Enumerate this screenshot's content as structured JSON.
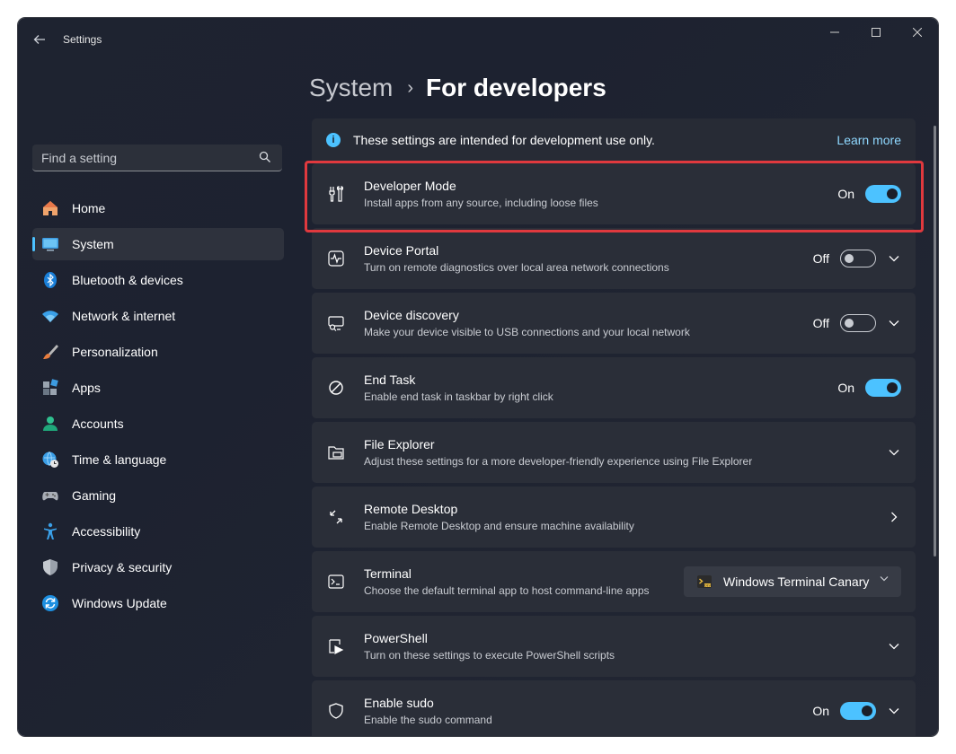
{
  "window": {
    "title": "Settings",
    "controls": {
      "minimize": "–",
      "maximize": "☐",
      "close": "✕"
    }
  },
  "search": {
    "placeholder": "Find a setting"
  },
  "sidebar": {
    "items": [
      {
        "label": "Home",
        "icon": "home-icon"
      },
      {
        "label": "System",
        "icon": "system-icon",
        "active": true
      },
      {
        "label": "Bluetooth & devices",
        "icon": "bluetooth-icon"
      },
      {
        "label": "Network & internet",
        "icon": "wifi-icon"
      },
      {
        "label": "Personalization",
        "icon": "brush-icon"
      },
      {
        "label": "Apps",
        "icon": "apps-icon"
      },
      {
        "label": "Accounts",
        "icon": "account-icon"
      },
      {
        "label": "Time & language",
        "icon": "globe-clock-icon"
      },
      {
        "label": "Gaming",
        "icon": "gamepad-icon"
      },
      {
        "label": "Accessibility",
        "icon": "accessibility-icon"
      },
      {
        "label": "Privacy & security",
        "icon": "shield-icon"
      },
      {
        "label": "Windows Update",
        "icon": "update-icon"
      }
    ]
  },
  "breadcrumb": {
    "parent": "System",
    "separator": "›",
    "current": "For developers"
  },
  "info": {
    "text": "These settings are intended for development use only.",
    "link": "Learn more"
  },
  "settings": [
    {
      "title": "Developer Mode",
      "subtitle": "Install apps from any source, including loose files",
      "state": "On",
      "icon": "developer-tools-icon"
    },
    {
      "title": "Device Portal",
      "subtitle": "Turn on remote diagnostics over local area network connections",
      "state": "Off",
      "icon": "device-portal-icon"
    },
    {
      "title": "Device discovery",
      "subtitle": "Make your device visible to USB connections and your local network",
      "state": "Off",
      "icon": "device-discovery-icon"
    },
    {
      "title": "End Task",
      "subtitle": "Enable end task in taskbar by right click",
      "state": "On",
      "icon": "end-task-icon"
    },
    {
      "title": "File Explorer",
      "subtitle": "Adjust these settings for a more developer-friendly experience using File Explorer",
      "icon": "folder-icon"
    },
    {
      "title": "Remote Desktop",
      "subtitle": "Enable Remote Desktop and ensure machine availability",
      "icon": "remote-desktop-icon"
    },
    {
      "title": "Terminal",
      "subtitle": "Choose the default terminal app to host command-line apps",
      "dropdown": "Windows Terminal Canary",
      "icon": "terminal-icon"
    },
    {
      "title": "PowerShell",
      "subtitle": "Turn on these settings to execute PowerShell scripts",
      "icon": "powershell-icon"
    },
    {
      "title": "Enable sudo",
      "subtitle": "Enable the sudo command",
      "state": "On",
      "icon": "sudo-shield-icon"
    }
  ],
  "colors": {
    "accent": "#4cc2ff",
    "highlight": "#e0393e",
    "card": "#2a2e38"
  }
}
